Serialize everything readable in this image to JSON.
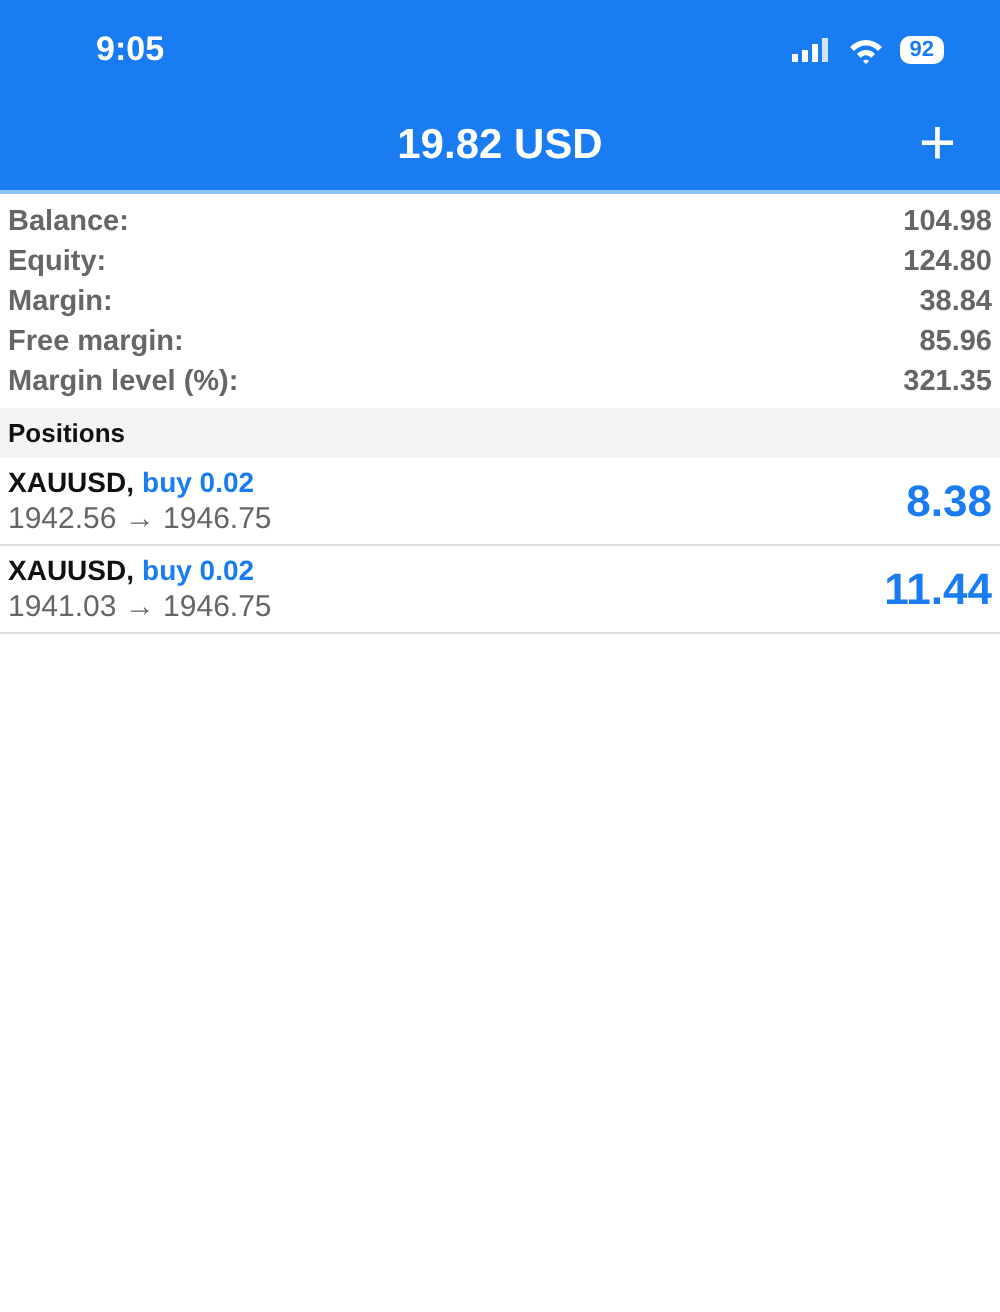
{
  "status_bar": {
    "time": "9:05",
    "battery": "92"
  },
  "header": {
    "title": "19.82 USD",
    "action": "+"
  },
  "summary": [
    {
      "label": "Balance:",
      "value": "104.98"
    },
    {
      "label": "Equity:",
      "value": "124.80"
    },
    {
      "label": "Margin:",
      "value": "38.84"
    },
    {
      "label": "Free margin:",
      "value": "85.96"
    },
    {
      "label": "Margin level (%):",
      "value": "321.35"
    }
  ],
  "positions": {
    "title": "Positions",
    "items": [
      {
        "symbol": "XAUUSD,",
        "order": "buy 0.02",
        "prices": "1942.56 → 1946.75",
        "profit": "8.38"
      },
      {
        "symbol": "XAUUSD,",
        "order": "buy 0.02",
        "prices": "1941.03 → 1946.75",
        "profit": "11.44"
      }
    ]
  }
}
